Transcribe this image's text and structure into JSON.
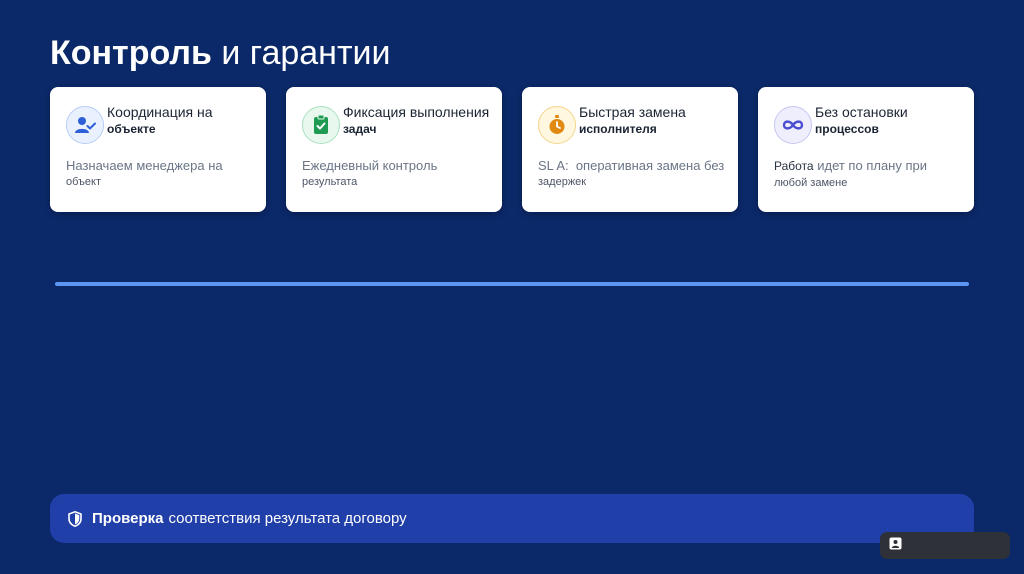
{
  "slide": {
    "title_bold": "Контроль",
    "title_rest": " и гарантии"
  },
  "cards": [
    {
      "icon": "person-check-icon",
      "title_line1": "Координация на",
      "title_line2": "объекте",
      "desc_line1": "Назначаем менеджера на",
      "desc_line2": "объект",
      "accent": "#2f5fd6"
    },
    {
      "icon": "clipboard-check-icon",
      "title_line1": "Фиксация выполнения",
      "title_line2": "задач",
      "desc_line1": "Ежедневный контроль",
      "desc_line2": "результата",
      "accent": "#1f9a52"
    },
    {
      "icon": "stopwatch-icon",
      "title_line1": "Быстрая замена",
      "title_line2": "исполнителя",
      "desc_line1": "SL A:  оперативная замена без",
      "desc_line2": "задержек",
      "accent": "#e08a12"
    },
    {
      "icon": "infinity-icon",
      "title_line1": "Без остановки",
      "title_line2": "процессов",
      "desc_strong": "Работа",
      "desc_line1": " идет по плану при",
      "desc_line2": "любой замене",
      "accent": "#4b4fcf"
    }
  ],
  "banner": {
    "icon": "shield-icon",
    "bold": "Проверка",
    "text": "соответствия результата договору"
  },
  "widget": {
    "icon": "presenter-icon"
  },
  "colors": {
    "background": "#0b2868",
    "divider": "#5b96f2",
    "banner": "#203fa8"
  }
}
